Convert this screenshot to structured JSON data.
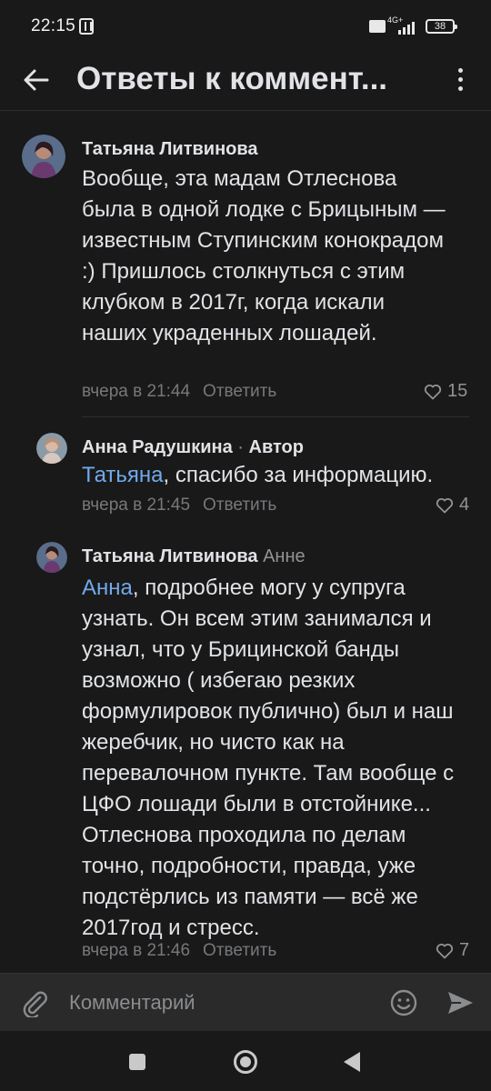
{
  "status_bar": {
    "time": "22:15",
    "network": "4G+",
    "battery": "38"
  },
  "header": {
    "title": "Ответы к коммент...",
    "back_icon": "arrow-left-icon",
    "menu_icon": "more-vertical-icon"
  },
  "comments": [
    {
      "author": "Татьяна Литвинова",
      "text": "Вообще, эта мадам Отлеснова была в одной лодке с Брицыным — известным Ступинским конокрадом :) Пришлось столкнуться с этим клубком в 2017г, когда искали наших украденных лошадей.",
      "time": "вчера в 21:44",
      "reply_label": "Ответить",
      "likes": "15"
    },
    {
      "author": "Анна Радушкина",
      "separator": "·",
      "badge": "Автор",
      "mention": "Татьяна",
      "text": ", спасибо за информацию.",
      "time": "вчера в 21:45",
      "reply_label": "Ответить",
      "likes": "4"
    },
    {
      "author": "Татьяна Литвинова",
      "reply_to": "Анне",
      "mention": "Анна",
      "text": ", подробнее могу у супруга узнать. Он всем этим занимался и узнал, что у Брицинской банды возможно ( избегаю резких формулировок публично) был и наш жеребчик, но чисто как на перевалочном пункте. Там вообще с ЦФО лошади были в отстойнике... Отлеснова проходила по делам точно, подробности, правда, уже подстёрлись из памяти — всё же 2017год и стресс.",
      "time": "вчера в 21:46",
      "reply_label": "Ответить",
      "likes": "7"
    }
  ],
  "composer": {
    "placeholder": "Комментарий",
    "attach_icon": "paperclip-icon",
    "emoji_icon": "smile-icon",
    "send_icon": "send-icon"
  },
  "colors": {
    "background": "#19191a",
    "text": "#e1e3e6",
    "secondary": "#76787a",
    "mention": "#71aaeb",
    "composer": "#2a2a2b"
  }
}
